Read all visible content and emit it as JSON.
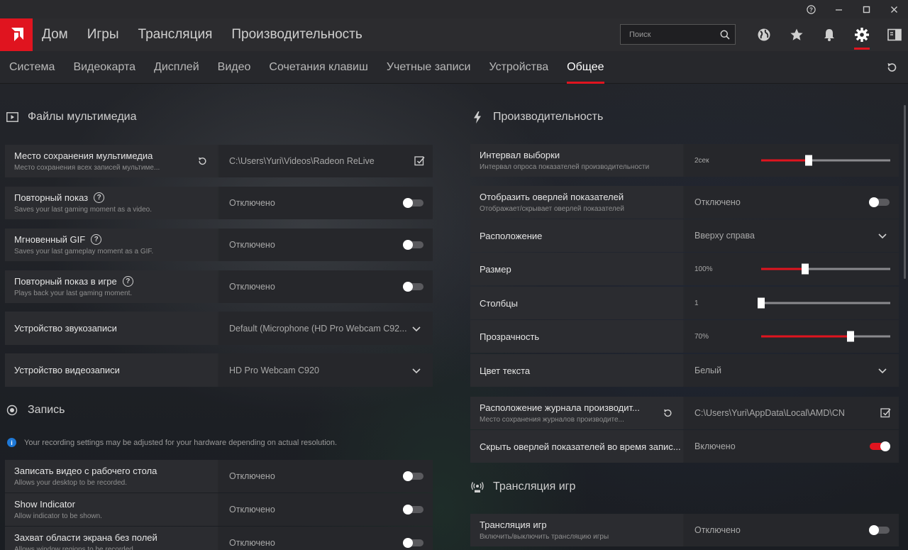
{
  "titlebar": {
    "help_icon": "help-circle-icon",
    "minimize_icon": "minimize-icon",
    "maximize_icon": "maximize-icon",
    "close_icon": "close-icon"
  },
  "nav": {
    "items": [
      "Дом",
      "Игры",
      "Трансляция",
      "Производительность"
    ],
    "search_placeholder": "Поиск"
  },
  "accent_color": "#e0141f",
  "tabs": [
    {
      "label": "Система",
      "active": false
    },
    {
      "label": "Видеокарта",
      "active": false
    },
    {
      "label": "Дисплей",
      "active": false
    },
    {
      "label": "Видео",
      "active": false
    },
    {
      "label": "Сочетания клавиш",
      "active": false
    },
    {
      "label": "Учетные записи",
      "active": false
    },
    {
      "label": "Устройства",
      "active": false
    },
    {
      "label": "Общее",
      "active": true
    }
  ],
  "left": {
    "media_title": "Файлы мультимедиа",
    "media_rows": [
      {
        "title": "Место сохранения мультимедиа",
        "sub": "Место сохранения всех записей мультиме...",
        "value": "C:\\Users\\Yuri\\Videos\\Radeon ReLive",
        "control": "edit"
      },
      {
        "title": "Повторный показ",
        "sub": "Saves your last gaming moment as a video.",
        "value": "Отключено",
        "control": "toggle",
        "on": false,
        "help": true
      },
      {
        "title": "Мгновенный GIF",
        "sub": "Saves your last gameplay moment as a GIF.",
        "value": "Отключено",
        "control": "toggle",
        "on": false,
        "help": true
      },
      {
        "title": "Повторный показ в игре",
        "sub": "Plays back your last gaming moment.",
        "value": "Отключено",
        "control": "toggle",
        "on": false,
        "help": true
      },
      {
        "title": "Устройство звукозаписи",
        "sub": "",
        "value": "Default (Microphone (HD Pro Webcam C92...",
        "control": "dropdown"
      },
      {
        "title": "Устройство видеозаписи",
        "sub": "",
        "value": "HD Pro Webcam C920",
        "control": "dropdown"
      }
    ],
    "record_title": "Запись",
    "record_info": "Your recording settings may be adjusted for your hardware depending on actual resolution.",
    "record_rows": [
      {
        "title": "Записать видео с рабочего стола",
        "sub": "Allows your desktop to be recorded.",
        "value": "Отключено",
        "on": false
      },
      {
        "title": "Show Indicator",
        "sub": "Allow indicator to be shown.",
        "value": "Отключено",
        "on": false
      },
      {
        "title": "Захват области экрана без полей",
        "sub": "Allows window regions to be recorded.",
        "value": "Отключено",
        "on": false
      }
    ]
  },
  "right": {
    "perf_title": "Производительность",
    "sample": {
      "title": "Интервал выборки",
      "sub": "Интервал опроса показателей производительности",
      "value": "2сек",
      "level": 0.37
    },
    "overlay_rows": [
      {
        "title": "Отобразить оверлей показателей",
        "sub": "Отображает/скрывает оверлей показателей",
        "value": "Отключено",
        "control": "toggle",
        "on": false
      },
      {
        "title": "Расположение",
        "sub": "",
        "value": "Вверху справа",
        "control": "dropdown"
      },
      {
        "title": "Размер",
        "sub": "",
        "value": "100%",
        "control": "slider",
        "level": 0.34
      },
      {
        "title": "Столбцы",
        "sub": "",
        "value": "1",
        "control": "slider",
        "level": 0.0
      },
      {
        "title": "Прозрачность",
        "sub": "",
        "value": "70%",
        "control": "slider",
        "level": 0.69
      },
      {
        "title": "Цвет текста",
        "sub": "",
        "value": "Белый",
        "control": "dropdown"
      }
    ],
    "log_rows": [
      {
        "title": "Расположение журнала производит...",
        "sub": "Место сохранения журналов производите...",
        "value": "C:\\Users\\Yuri\\AppData\\Local\\AMD\\CN",
        "control": "edit"
      },
      {
        "title": "Скрыть оверлей показателей во время запис...",
        "sub": "",
        "value": "Включено",
        "control": "toggle",
        "on": true
      }
    ],
    "stream_title": "Трансляция игр",
    "stream_row": {
      "title": "Трансляция игр",
      "sub": "Включить/выключить трансляцию игры",
      "value": "Отключено",
      "on": false
    }
  }
}
